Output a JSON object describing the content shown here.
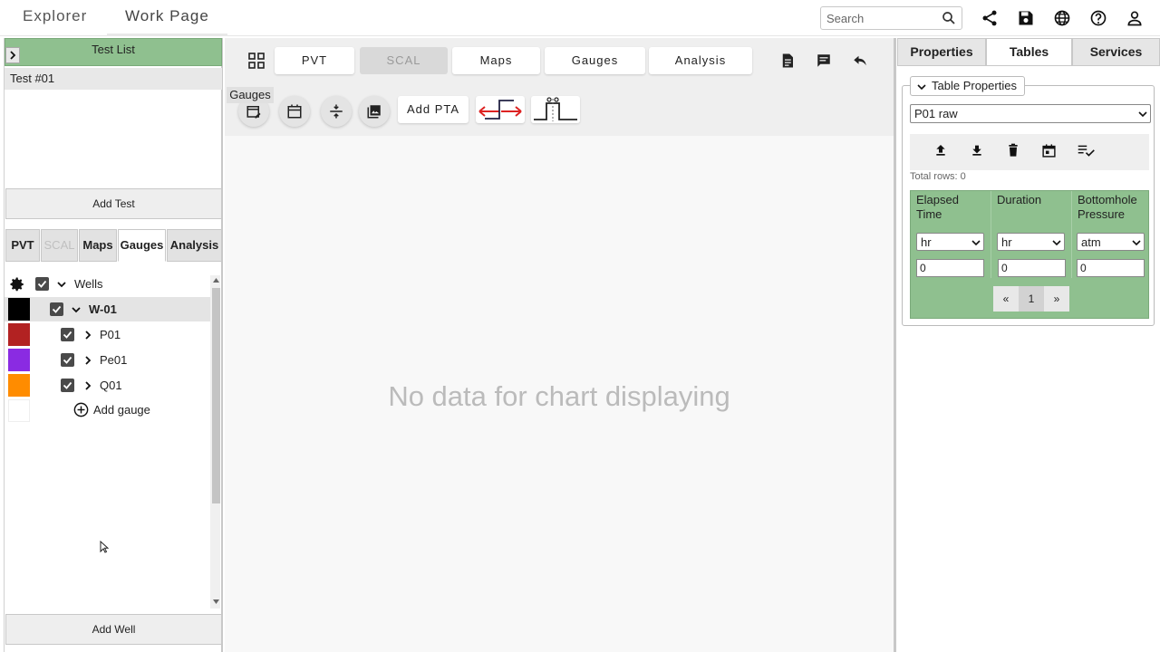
{
  "header": {
    "tabs": [
      "Explorer",
      "Work Page"
    ],
    "search_placeholder": "Search",
    "icons": [
      "share-icon",
      "save-icon",
      "globe-icon",
      "help-icon",
      "user-icon"
    ]
  },
  "left": {
    "test_list_title": "Test List",
    "tests": [
      "Test #01"
    ],
    "add_test_label": "Add Test",
    "tabs": [
      "PVT",
      "SCAL",
      "Maps",
      "Gauges",
      "Analysis"
    ],
    "tree": {
      "root": "Wells",
      "well": "W-01",
      "gauges": [
        {
          "name": "P01",
          "color": "#b22222"
        },
        {
          "name": "Pe01",
          "color": "#8a2be2"
        },
        {
          "name": "Q01",
          "color": "#ff8c00"
        }
      ],
      "well_color": "#000000",
      "add_gauge_label": "Add gauge"
    },
    "add_well_label": "Add Well"
  },
  "center": {
    "tabs": [
      "PVT",
      "SCAL",
      "Maps",
      "Gauges",
      "Analysis"
    ],
    "tooltip": "Gauges",
    "add_pta_label": "Add PTA",
    "no_data_text": "No data for chart displaying"
  },
  "right": {
    "tabs": [
      "Properties",
      "Tables",
      "Services"
    ],
    "table_properties_label": "Table Properties",
    "table_select_value": "P01 raw",
    "total_rows_text": "Total rows: 0",
    "columns": [
      {
        "header": "Elapsed Time",
        "unit": "hr",
        "value": "0"
      },
      {
        "header": "Duration",
        "unit": "hr",
        "value": "0"
      },
      {
        "header": "Bottomhole Pressure",
        "unit": "atm",
        "value": "0"
      }
    ],
    "pager": [
      "«",
      "1",
      "»"
    ]
  }
}
